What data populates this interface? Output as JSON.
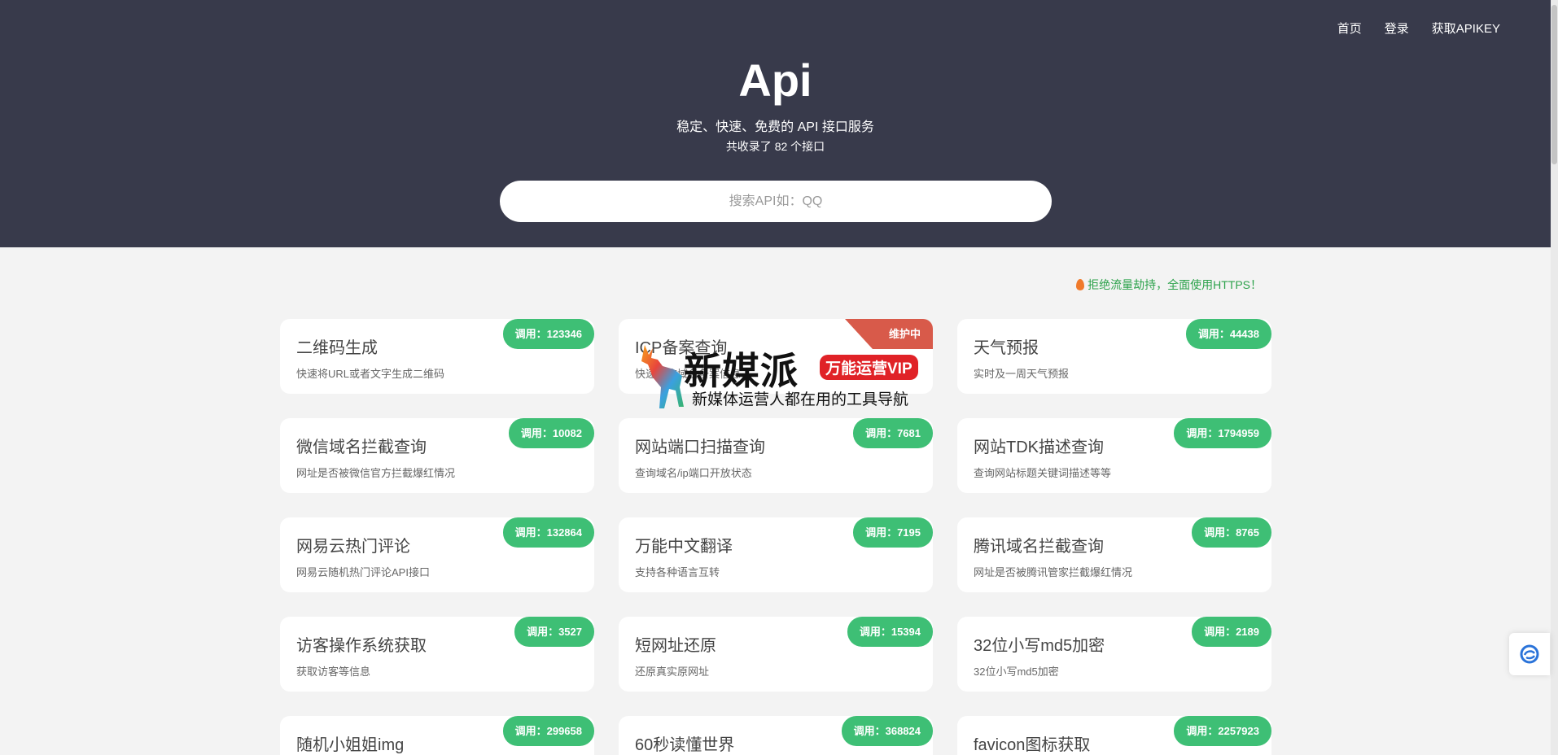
{
  "nav": {
    "home": "首页",
    "login": "登录",
    "apikey": "获取APIKEY"
  },
  "hero": {
    "title": "Api",
    "slogan": "稳定、快速、免费的 API 接口服务",
    "count": "共收录了 82 个接口",
    "search_placeholder": "搜索API如：QQ"
  },
  "notice": "拒绝流量劫持，全面使用HTTPS！",
  "watermark": {
    "main": "新媒派",
    "vip": "万能运营VIP",
    "sub": "新媒体运营人都在用的工具导航"
  },
  "colors": {
    "hero_bg": "#383a4b",
    "badge": "#3ebf75",
    "maintenance": "#d85a4a",
    "notice": "#2ca24b"
  },
  "cards": [
    {
      "title": "二维码生成",
      "desc": "快速将URL或者文字生成二维码",
      "badge": "调用：123346"
    },
    {
      "title": "ICP备案查询",
      "desc": "快速查询域名备案信息",
      "badge": "维护中",
      "status": "maintenance"
    },
    {
      "title": "天气预报",
      "desc": "实时及一周天气预报",
      "badge": "调用：44438"
    },
    {
      "title": "微信域名拦截查询",
      "desc": "网址是否被微信官方拦截爆红情况",
      "badge": "调用：10082"
    },
    {
      "title": "网站端口扫描查询",
      "desc": "查询域名/ip端口开放状态",
      "badge": "调用：7681"
    },
    {
      "title": "网站TDK描述查询",
      "desc": "查询网站标题关键词描述等等",
      "badge": "调用：1794959"
    },
    {
      "title": "网易云热门评论",
      "desc": "网易云随机热门评论API接口",
      "badge": "调用：132864"
    },
    {
      "title": "万能中文翻译",
      "desc": "支持各种语言互转",
      "badge": "调用：7195"
    },
    {
      "title": "腾讯域名拦截查询",
      "desc": "网址是否被腾讯管家拦截爆红情况",
      "badge": "调用：8765"
    },
    {
      "title": "访客操作系统获取",
      "desc": "获取访客等信息",
      "badge": "调用：3527"
    },
    {
      "title": "短网址还原",
      "desc": "还原真实原网址",
      "badge": "调用：15394"
    },
    {
      "title": "32位小写md5加密",
      "desc": "32位小写md5加密",
      "badge": "调用：2189"
    },
    {
      "title": "随机小姐姐img",
      "desc": "",
      "badge": "调用：299658"
    },
    {
      "title": "60秒读懂世界",
      "desc": "",
      "badge": "调用：368824"
    },
    {
      "title": "favicon图标获取",
      "desc": "",
      "badge": "调用：2257923"
    }
  ]
}
